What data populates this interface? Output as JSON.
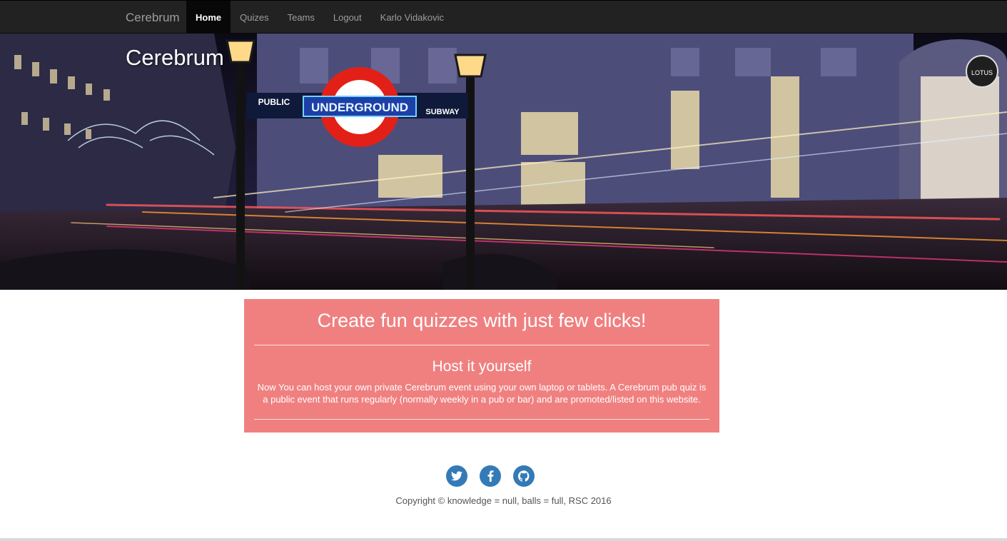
{
  "navbar": {
    "brand": "Cerebrum",
    "items": [
      {
        "label": "Home",
        "active": true
      },
      {
        "label": "Quizes",
        "active": false
      },
      {
        "label": "Teams",
        "active": false
      },
      {
        "label": "Logout",
        "active": false
      },
      {
        "label": "Karlo Vidakovic",
        "active": false
      }
    ]
  },
  "hero": {
    "title": "Cerebrum",
    "sign_left": "PUBLIC",
    "sign_center": "UNDERGROUND",
    "sign_right": "SUBWAY",
    "shop_logo": "LOTUS"
  },
  "card": {
    "headline": "Create fun quizzes with just few clicks!",
    "subtitle": "Host it yourself",
    "body": "Now You can host your own private Cerebrum event using your own laptop or tablets. A Cerebrum pub quiz is a public event that runs regularly (normally weekly in a pub or bar) and are promoted/listed on this website."
  },
  "footer": {
    "social_icons": [
      "twitter-icon",
      "facebook-icon",
      "github-icon"
    ],
    "copyright": "Copyright © knowledge = null, balls = full, RSC 2016"
  },
  "colors": {
    "navbar_bg": "#222222",
    "card_bg": "#f08080",
    "social_bg": "#337ab7"
  }
}
